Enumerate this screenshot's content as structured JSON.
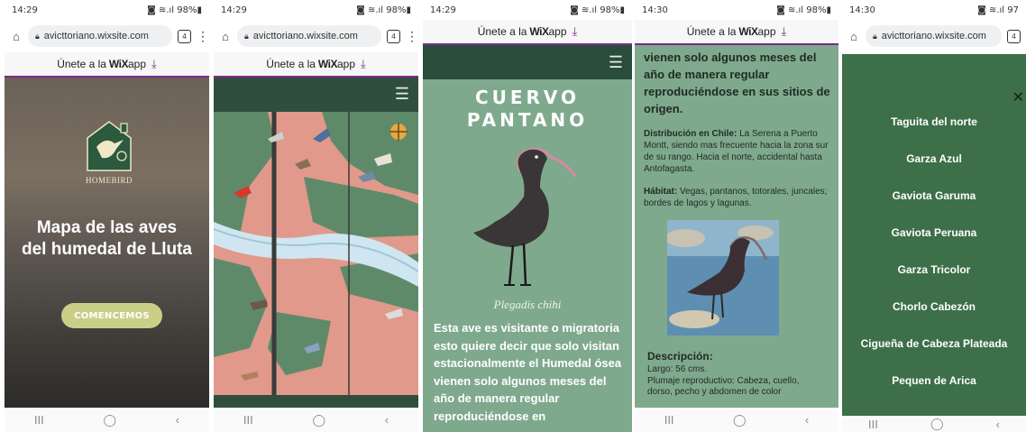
{
  "panel1": {
    "status_time": "14:29",
    "status_icons": "◙ ≋.ıl 98%▮",
    "url": "avicttoriano.wixsite.com",
    "tabs_count": "4",
    "wix_prefix": "Únete a la",
    "wix_brand": "WiX",
    "wix_suffix": "app",
    "logo_text": "HOMEBIRD",
    "hero_title_line1": "Mapa de las aves",
    "hero_title_line2": "del humedal de Lluta",
    "cta_label": "COMENCEMOS"
  },
  "panel2": {
    "status_time": "14:29",
    "status_icons": "◙ ≋.ıl 98%▮",
    "url": "avicttoriano.wixsite.com",
    "tabs_count": "4",
    "wix_prefix": "Únete a la",
    "wix_brand": "WiX",
    "wix_suffix": "app"
  },
  "panel3": {
    "status_time": "14:29",
    "status_icons": "◙ ≋.ıl 98%▮",
    "wix_prefix": "Únete a la",
    "wix_brand": "WiX",
    "wix_suffix": "app",
    "title_line1": "CUERVO",
    "title_line2": "PANTANO",
    "scientific_name": "Plegadis chihi",
    "body": "Esta ave es visitante o migratoria esto quiere decir que solo visitan estacionalmente el Humedal ósea vienen solo algunos meses del año de manera regular reproduciéndose en"
  },
  "panel4": {
    "status_time": "14:30",
    "status_icons": "◙ ≋.ıl 98%▮",
    "wix_prefix": "Únete a la",
    "wix_brand": "WiX",
    "wix_suffix": "app",
    "intro": "vienen solo algunos meses del año de manera regular reproduciéndose en sus sitios de origen.",
    "dist_label": "Distribución en Chile:",
    "dist_text": " La Serena a Puerto Montt, siendo mas frecuente hacia la zona sur de su rango. Hacia el norte, accidental hasta Antofagasta.",
    "habitat_label": "Hábitat:",
    "habitat_text": " Vegas, pantanos, totorales, juncales; bordes de lagos y lagunas.",
    "desc_heading": "Descripción:",
    "desc_line1": "Largo: 56 cms.",
    "desc_line2": "Plumaje reproductivo: Cabeza, cuello, dorso, pecho y abdomen de color"
  },
  "panel5": {
    "status_time": "14:30",
    "status_icons": "◙ ≋.ıl 97",
    "url": "avicttoriano.wixsite.com",
    "tabs_count": "4",
    "menu": [
      "Taguita del norte",
      "Garza Azul",
      "Gaviota Garuma",
      "Gaviota Peruana",
      "Garza Tricolor",
      "Chorlo Cabezón",
      "Cigueña de Cabeza Plateada",
      "Pequen de Arica"
    ]
  },
  "nav": {
    "recents": "III",
    "home": "◯",
    "back": "‹"
  },
  "colors": {
    "dark_green": "#294d3a",
    "sage": "#7fa98d",
    "menu_green": "#3d7048",
    "wix_purple": "#7b2a8e",
    "cta": "#c9cf86"
  }
}
